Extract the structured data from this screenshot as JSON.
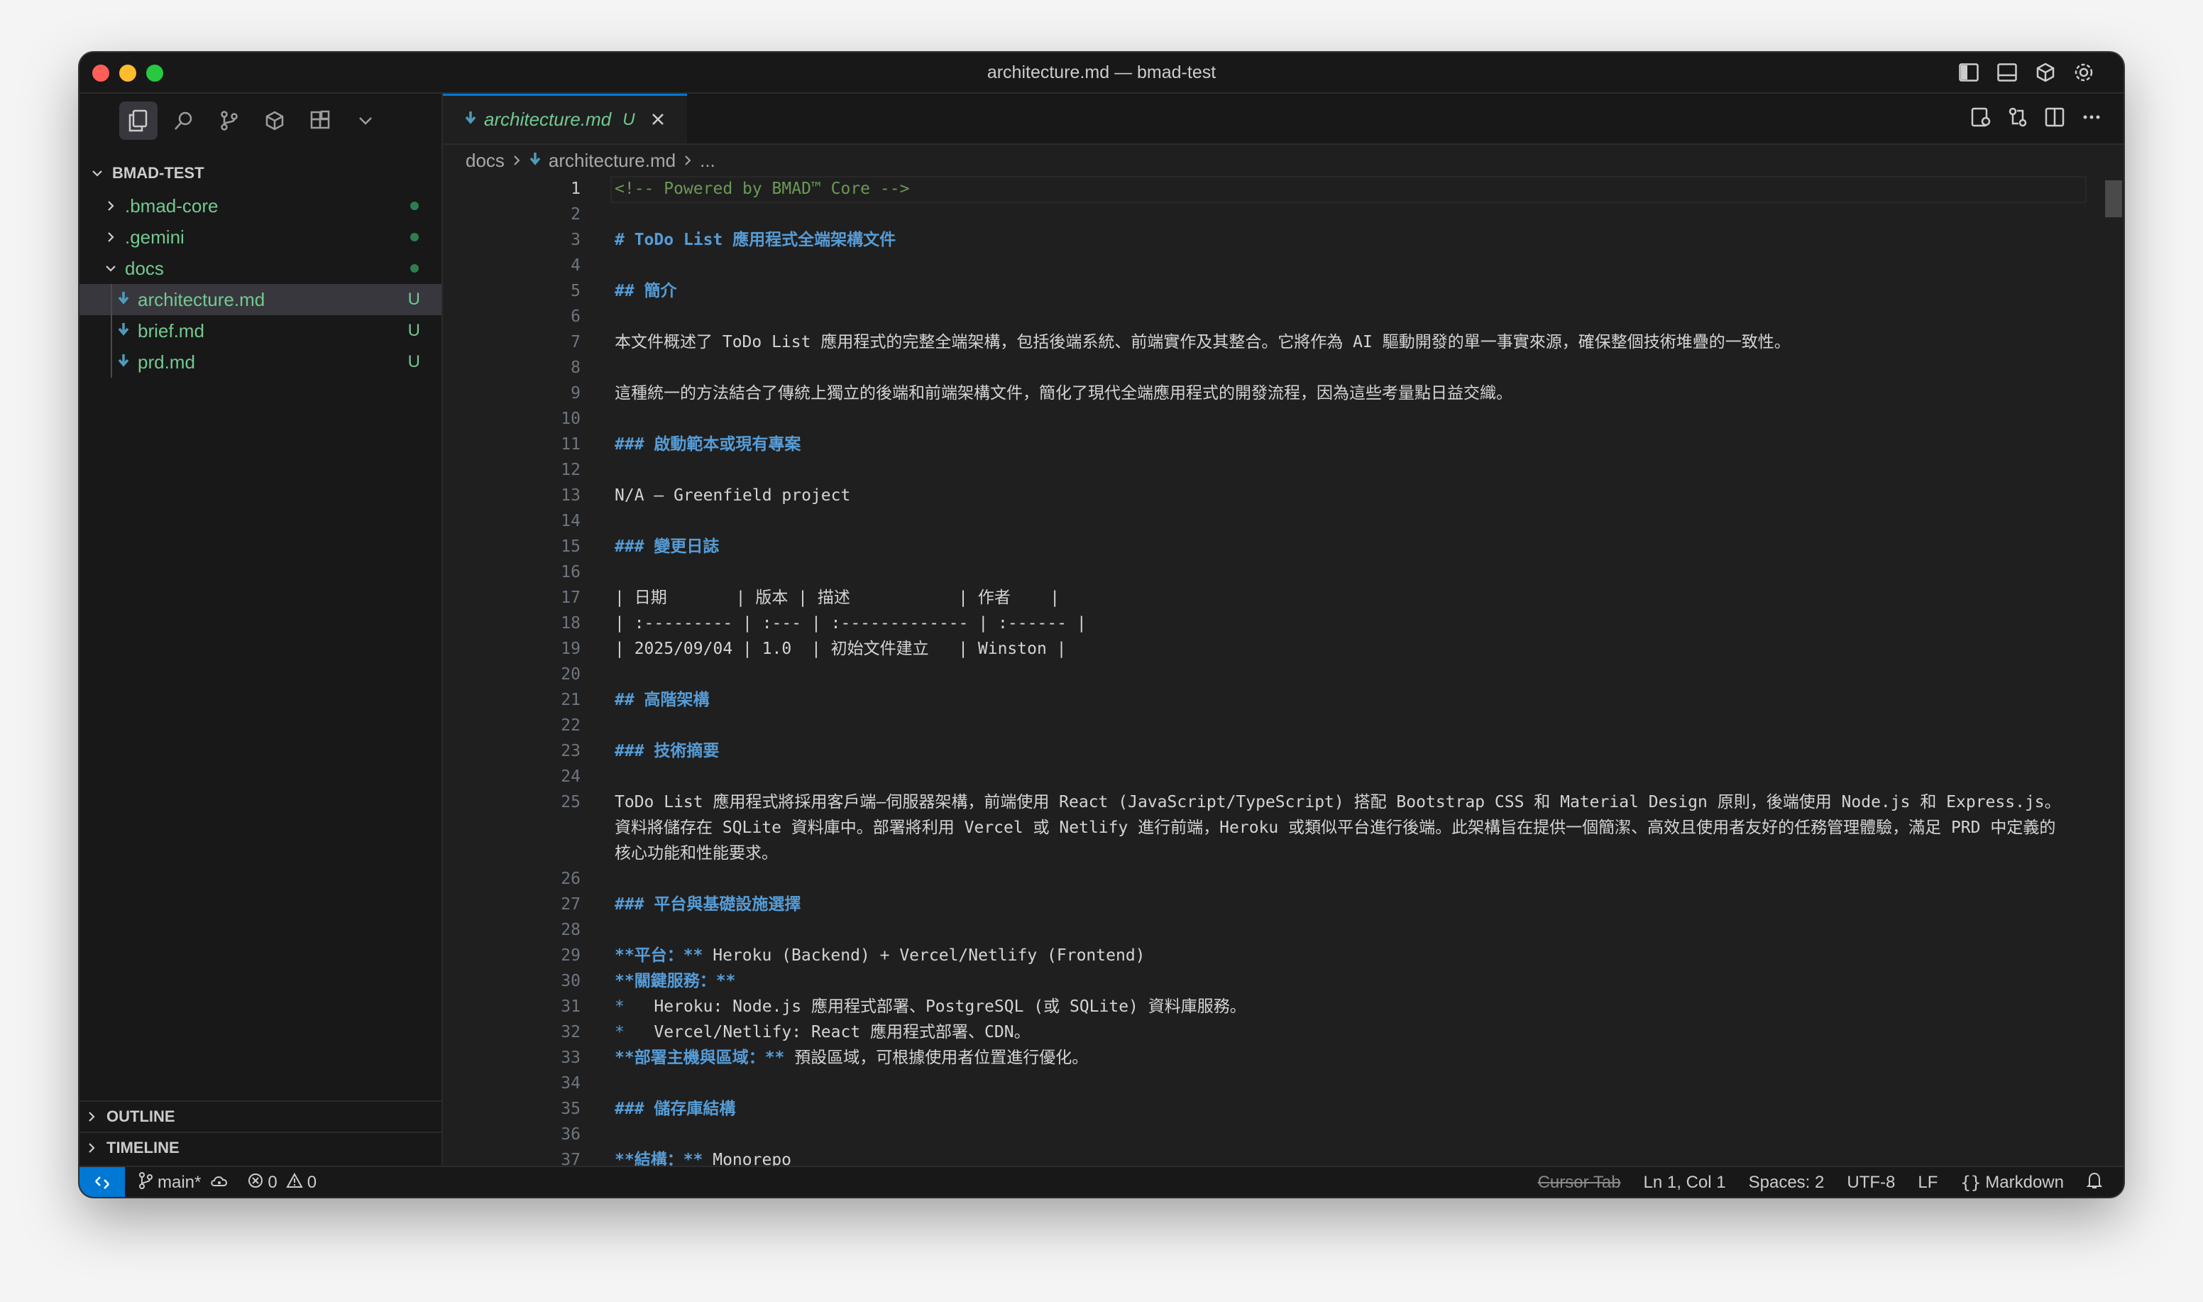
{
  "window": {
    "title": "architecture.md — bmad-test"
  },
  "explorer": {
    "root": "BMAD-TEST",
    "items": [
      {
        "label": ".bmad-core",
        "type": "folder"
      },
      {
        "label": ".gemini",
        "type": "folder"
      },
      {
        "label": "docs",
        "type": "folder-open"
      },
      {
        "label": "architecture.md",
        "badge": "U"
      },
      {
        "label": "brief.md",
        "badge": "U"
      },
      {
        "label": "prd.md",
        "badge": "U"
      }
    ],
    "outline": "OUTLINE",
    "timeline": "TIMELINE"
  },
  "tab": {
    "name": "architecture.md",
    "badge": "U"
  },
  "breadcrumb": {
    "folder": "docs",
    "file": "architecture.md",
    "more": "..."
  },
  "editor": {
    "lines": [
      {
        "n": "1",
        "text": "<!-- Powered by BMAD™ Core -->"
      },
      {
        "n": "2",
        "text": ""
      },
      {
        "n": "3",
        "text": "# ToDo List 應用程式全端架構文件"
      },
      {
        "n": "4",
        "text": ""
      },
      {
        "n": "5",
        "text": "## 簡介"
      },
      {
        "n": "6",
        "text": ""
      },
      {
        "n": "7",
        "text": "本文件概述了 ToDo List 應用程式的完整全端架構，包括後端系統、前端實作及其整合。它將作為 AI 驅動開發的單一事實來源，確保整個技術堆疊的一致性。"
      },
      {
        "n": "8",
        "text": ""
      },
      {
        "n": "9",
        "text": "這種統一的方法結合了傳統上獨立的後端和前端架構文件，簡化了現代全端應用程式的開發流程，因為這些考量點日益交織。"
      },
      {
        "n": "10",
        "text": ""
      },
      {
        "n": "11",
        "text": "### 啟動範本或現有專案"
      },
      {
        "n": "12",
        "text": ""
      },
      {
        "n": "13",
        "text": "N/A – Greenfield project"
      },
      {
        "n": "14",
        "text": ""
      },
      {
        "n": "15",
        "text": "### 變更日誌"
      },
      {
        "n": "16",
        "text": ""
      },
      {
        "n": "17",
        "text": "| 日期       | 版本 | 描述           | 作者    |"
      },
      {
        "n": "18",
        "text": "| :--------- | :--- | :------------- | :------ |"
      },
      {
        "n": "19",
        "text": "| 2025/09/04 | 1.0  | 初始文件建立   | Winston |"
      },
      {
        "n": "20",
        "text": ""
      },
      {
        "n": "21",
        "text": "## 高階架構"
      },
      {
        "n": "22",
        "text": ""
      },
      {
        "n": "23",
        "text": "### 技術摘要"
      },
      {
        "n": "24",
        "text": ""
      },
      {
        "n": "25",
        "text": "ToDo List 應用程式將採用客戶端–伺服器架構，前端使用 React (JavaScript/TypeScript) 搭配 Bootstrap CSS 和 Material Design 原則，後端使用 Node.js 和 Express.js。資料將儲存在 SQLite 資料庫中。部署將利用 Vercel 或 Netlify 進行前端，Heroku 或類似平台進行後端。此架構旨在提供一個簡潔、高效且使用者友好的任務管理體驗，滿足 PRD 中定義的核心功能和性能要求。"
      },
      {
        "n": "26",
        "text": ""
      },
      {
        "n": "27",
        "text": "### 平台與基礎設施選擇"
      },
      {
        "n": "28",
        "text": ""
      },
      {
        "n": "29",
        "mark": "**平台：**",
        "text": " Heroku (Backend) + Vercel/Netlify (Frontend)"
      },
      {
        "n": "30",
        "mark": "**關鍵服務：**",
        "text": ""
      },
      {
        "n": "31",
        "bullet": "*",
        "text": "   Heroku: Node.js 應用程式部署、PostgreSQL (或 SQLite) 資料庫服務。"
      },
      {
        "n": "32",
        "bullet": "*",
        "text": "   Vercel/Netlify: React 應用程式部署、CDN。"
      },
      {
        "n": "33",
        "mark": "**部署主機與區域：**",
        "text": " 預設區域，可根據使用者位置進行優化。"
      },
      {
        "n": "34",
        "text": ""
      },
      {
        "n": "35",
        "text": "### 儲存庫結構"
      },
      {
        "n": "36",
        "text": ""
      },
      {
        "n": "37",
        "mark": "**結構：**",
        "text": " Monorepo"
      }
    ]
  },
  "status": {
    "branch": "main*",
    "errors": "0",
    "warnings": "0",
    "cursor_tab": "Cursor Tab",
    "position": "Ln 1, Col 1",
    "spaces": "Spaces: 2",
    "encoding": "UTF-8",
    "eol": "LF",
    "language": "Markdown"
  },
  "colors": {
    "accent": "#0078d4",
    "untracked": "#73c991",
    "heading": "#569cd6",
    "comment": "#6a9955"
  }
}
